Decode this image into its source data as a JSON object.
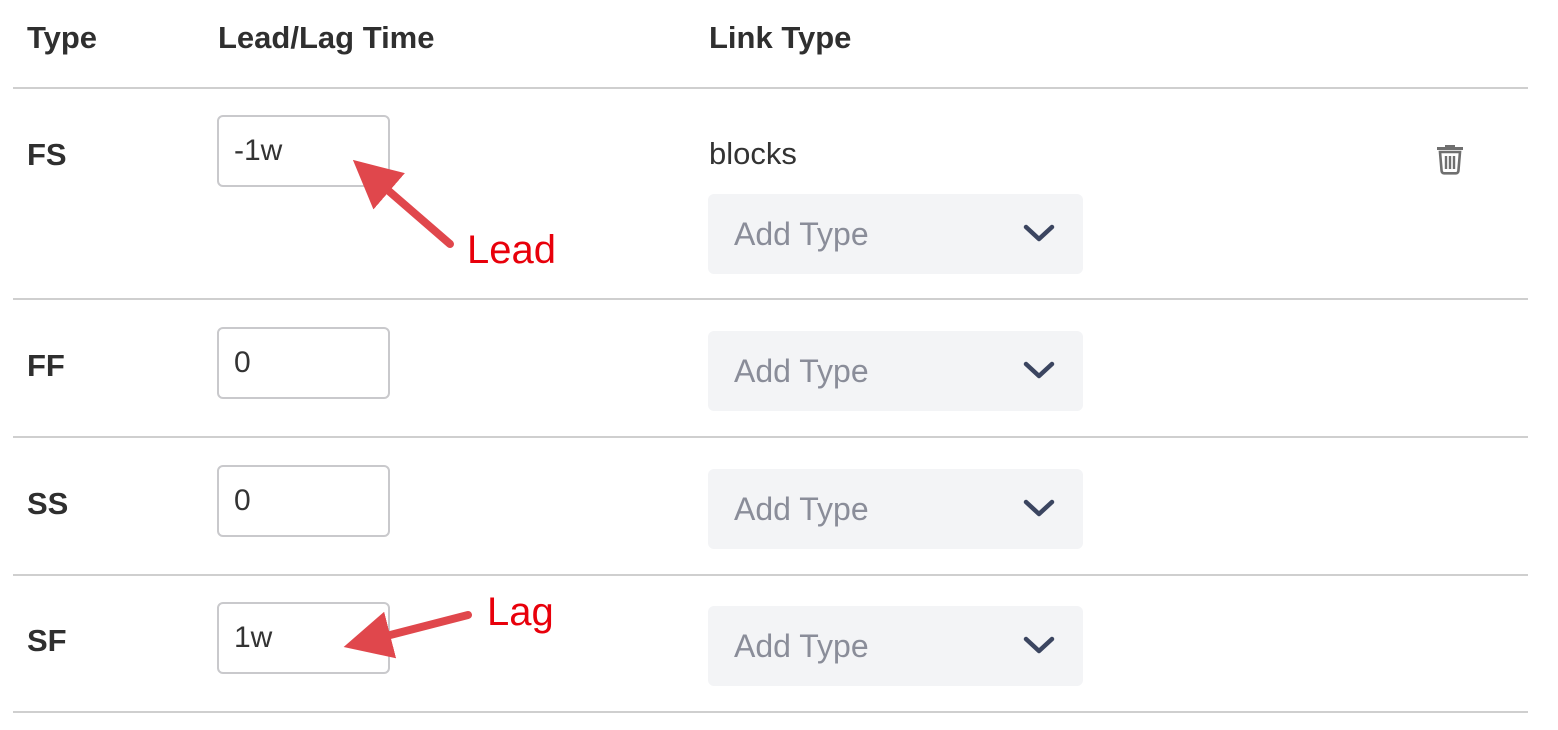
{
  "header": {
    "type": "Type",
    "lead_lag_time": "Lead/Lag Time",
    "link_type": "Link Type"
  },
  "rows": [
    {
      "type": "FS",
      "lead_lag": "-1w",
      "link_type_value": "blocks",
      "select_placeholder": "Add Type"
    },
    {
      "type": "FF",
      "lead_lag": "0",
      "select_placeholder": "Add Type"
    },
    {
      "type": "SS",
      "lead_lag": "0",
      "select_placeholder": "Add Type"
    },
    {
      "type": "SF",
      "lead_lag": "1w",
      "select_placeholder": "Add Type"
    }
  ],
  "annotations": {
    "lead": "Lead",
    "lag": "Lag"
  },
  "icons": {
    "delete": "trash-icon",
    "dropdown": "chevron-down-icon"
  },
  "colors": {
    "annotation": "#e8000b",
    "arrow": "#e0474c",
    "select_bg": "#f3f4f6",
    "chevron": "#3b4560"
  }
}
